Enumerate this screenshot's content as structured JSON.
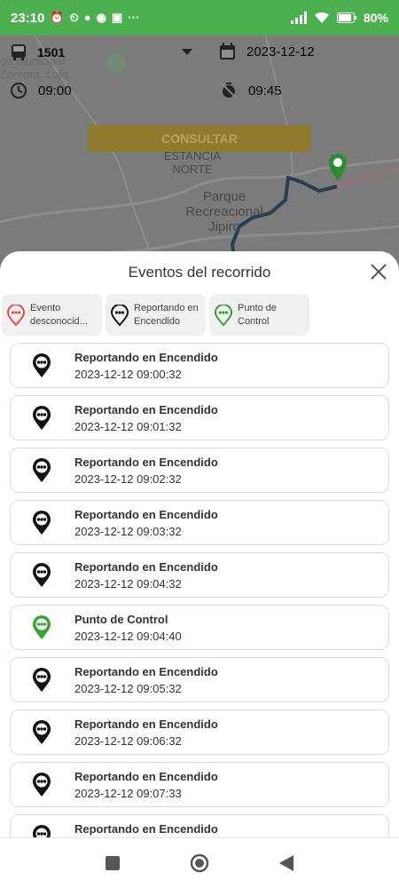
{
  "status_bar": {
    "time": "23:10",
    "battery": "80%"
  },
  "filters": {
    "vehicle": "1501",
    "date": "2023-12-12",
    "start_time": "09:00",
    "end_time": "09:45",
    "consult_label": "CONSULTAR"
  },
  "map": {
    "places": [
      "ESTANCIA\nNORTE",
      "Parque\nRecreacional\nJipiro",
      "go Municipal\nZamora, Loja"
    ]
  },
  "sheet": {
    "title": "Eventos del recorrido",
    "chips": [
      {
        "label": "Evento desconocid...",
        "color": "#e74c3c"
      },
      {
        "label": "Reportando en Encendido",
        "color": "#111111"
      },
      {
        "label": "Punto de Control",
        "color": "#3aa335"
      }
    ],
    "events": [
      {
        "title": "Reportando en Encendido",
        "time": "2023-12-12 09:00:32",
        "color": "#111111"
      },
      {
        "title": "Reportando en Encendido",
        "time": "2023-12-12 09:01:32",
        "color": "#111111"
      },
      {
        "title": "Reportando en Encendido",
        "time": "2023-12-12 09:02:32",
        "color": "#111111"
      },
      {
        "title": "Reportando en Encendido",
        "time": "2023-12-12 09:03:32",
        "color": "#111111"
      },
      {
        "title": "Reportando en Encendido",
        "time": "2023-12-12 09:04:32",
        "color": "#111111"
      },
      {
        "title": "Punto de Control",
        "time": "2023-12-12 09:04:40",
        "color": "#3aa335"
      },
      {
        "title": "Reportando en Encendido",
        "time": "2023-12-12 09:05:32",
        "color": "#111111"
      },
      {
        "title": "Reportando en Encendido",
        "time": "2023-12-12 09:06:32",
        "color": "#111111"
      },
      {
        "title": "Reportando en Encendido",
        "time": "2023-12-12 09:07:33",
        "color": "#111111"
      },
      {
        "title": "Reportando en Encendido",
        "time": "",
        "color": "#111111"
      }
    ]
  }
}
